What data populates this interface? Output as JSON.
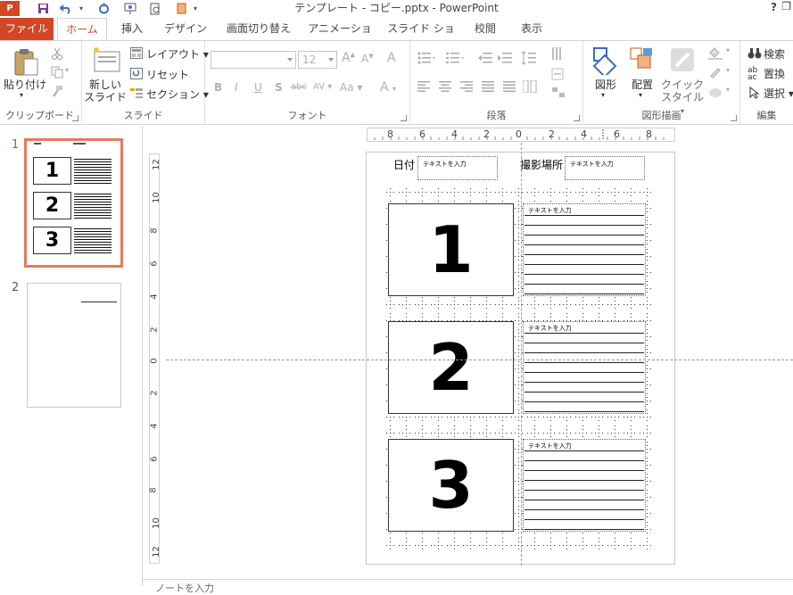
{
  "window": {
    "title": "テンプレート - コピー.pptx - PowerPoint",
    "app_logo": "P",
    "help": "?",
    "restore": "❐"
  },
  "tabs": [
    {
      "label": "ファイル"
    },
    {
      "label": "ホーム"
    },
    {
      "label": "挿入"
    },
    {
      "label": "デザイン"
    },
    {
      "label": "画面切り替え"
    },
    {
      "label": "アニメーション"
    },
    {
      "label": "スライド ショー"
    },
    {
      "label": "校閲"
    },
    {
      "label": "表示"
    }
  ],
  "ribbon": {
    "clipboard": {
      "paste": "貼り付け",
      "label": "クリップボード"
    },
    "slides": {
      "new_slide_1": "新しい",
      "new_slide_2": "スライド",
      "layout": "レイアウト",
      "reset": "リセット",
      "section": "セクション",
      "label": "スライド"
    },
    "font": {
      "size": "12",
      "bold": "B",
      "italic": "I",
      "underline": "U",
      "shadow": "S",
      "strike": "abc",
      "spacing": "AV",
      "case": "Aa",
      "color": "A",
      "grow": "A",
      "shrink": "A",
      "clear": "A",
      "label": "フォント"
    },
    "paragraph": {
      "label": "段落"
    },
    "drawing": {
      "shapes": "図形",
      "arrange": "配置",
      "quick_style_1": "クイック",
      "quick_style_2": "スタイル",
      "label": "図形描画"
    },
    "editing": {
      "find": "検索",
      "replace": "置換",
      "select": "選択",
      "label": "編集"
    }
  },
  "thumbnails": [
    {
      "number": "1",
      "boxes": [
        "1",
        "2",
        "3"
      ]
    },
    {
      "number": "2"
    }
  ],
  "hruler": {
    "ticks": [
      "8",
      "6",
      "4",
      "2",
      "0",
      "2",
      "4",
      "6",
      "8"
    ]
  },
  "vruler": {
    "ticks": [
      "12",
      "10",
      "8",
      "6",
      "4",
      "2",
      "0",
      "2",
      "4",
      "6",
      "8",
      "10",
      "12"
    ]
  },
  "slide": {
    "date_label": "日付",
    "location_label": "撮影場所",
    "placeholder": "テキストを入力",
    "boxes": [
      {
        "number": "1",
        "text_header": "テキストを入力"
      },
      {
        "number": "2",
        "text_header": "テキストを入力"
      },
      {
        "number": "3",
        "text_header": "テキストを入力"
      }
    ]
  },
  "notes": {
    "placeholder": "ノートを入力"
  },
  "colors": {
    "accent": "#d24726",
    "selection": "#e8785a"
  }
}
